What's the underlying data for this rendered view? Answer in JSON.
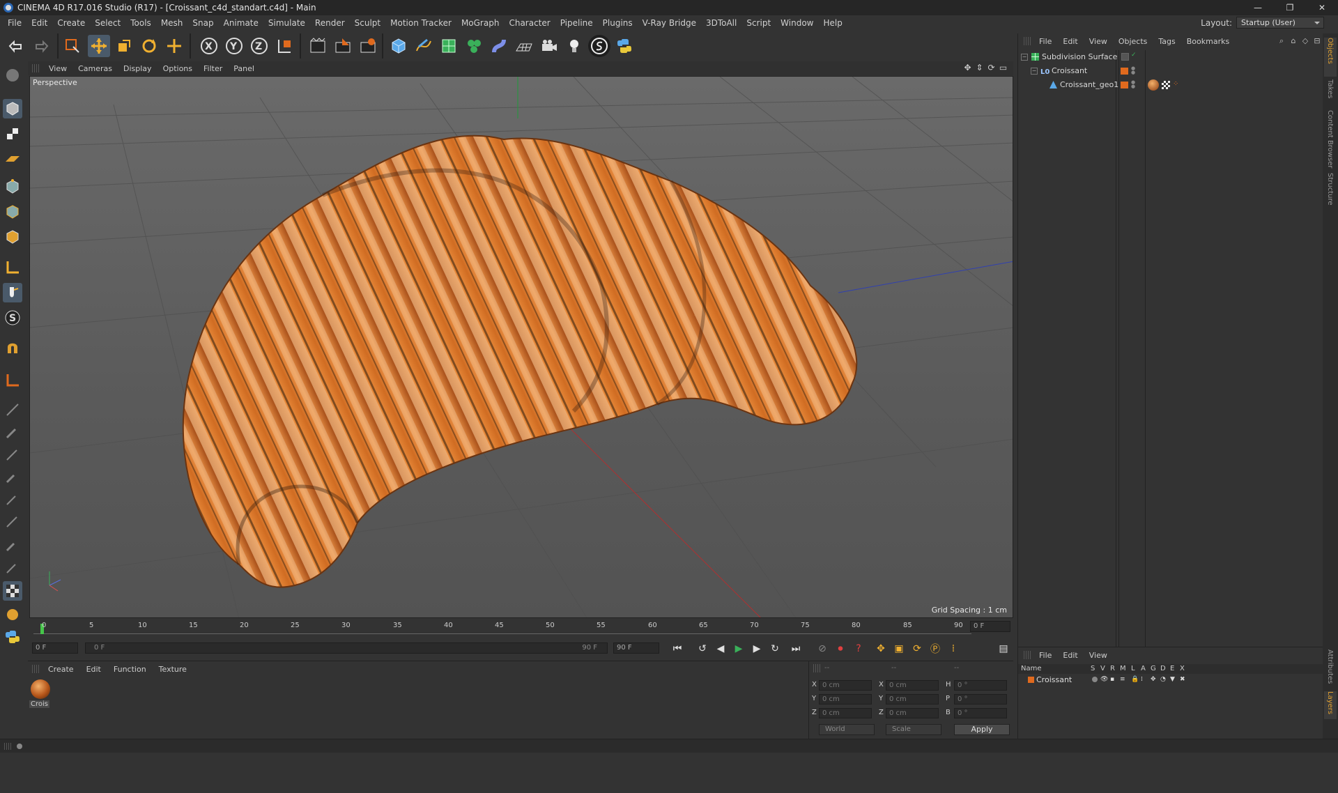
{
  "title": "CINEMA 4D R17.016 Studio (R17) - [Croissant_c4d_standart.c4d] - Main",
  "window_controls": [
    "—",
    "❐",
    "✕"
  ],
  "menu": [
    "File",
    "Edit",
    "Create",
    "Select",
    "Tools",
    "Mesh",
    "Snap",
    "Animate",
    "Simulate",
    "Render",
    "Sculpt",
    "Motion Tracker",
    "MoGraph",
    "Character",
    "Pipeline",
    "Plugins",
    "V-Ray Bridge",
    "3DToAll",
    "Script",
    "Window",
    "Help"
  ],
  "layout": {
    "label": "Layout:",
    "value": "Startup (User)"
  },
  "viewport": {
    "menu": [
      "View",
      "Cameras",
      "Display",
      "Options",
      "Filter",
      "Panel"
    ],
    "label": "Perspective",
    "grid_spacing": "Grid Spacing : 1 cm"
  },
  "timeline": {
    "ticks": [
      "0",
      "5",
      "10",
      "15",
      "20",
      "25",
      "30",
      "35",
      "40",
      "45",
      "50",
      "55",
      "60",
      "65",
      "70",
      "75",
      "80",
      "85",
      "90"
    ],
    "current_frame": "0 F",
    "start_field": "0 F",
    "range_start": "0 F",
    "range_end": "90 F",
    "end_field": "90 F"
  },
  "material_manager": {
    "menu": [
      "Create",
      "Edit",
      "Function",
      "Texture"
    ],
    "material_name": "Crois"
  },
  "coordinates": {
    "rows": [
      {
        "a1": "X",
        "v1": "0 cm",
        "a2": "X",
        "v2": "0 cm",
        "a3": "H",
        "v3": "0 °"
      },
      {
        "a1": "Y",
        "v1": "0 cm",
        "a2": "Y",
        "v2": "0 cm",
        "a3": "P",
        "v3": "0 °"
      },
      {
        "a1": "Z",
        "v1": "0 cm",
        "a2": "Z",
        "v2": "0 cm",
        "a3": "B",
        "v3": "0 °"
      }
    ],
    "header": [
      "--",
      "--",
      "--"
    ],
    "world": "World",
    "scale": "Scale",
    "apply": "Apply"
  },
  "objects_panel": {
    "menu": [
      "File",
      "Edit",
      "View",
      "Objects",
      "Tags",
      "Bookmarks"
    ],
    "items": [
      {
        "name": "Subdivision Surface"
      },
      {
        "name": "Croissant"
      },
      {
        "name": "Croissant_geo1"
      }
    ]
  },
  "side_tabs": [
    "Objects",
    "Takes",
    "Content Browser",
    "Structure"
  ],
  "side_tabs_bottom": [
    "Attributes",
    "Layers"
  ],
  "layers_panel": {
    "menu": [
      "File",
      "Edit",
      "View"
    ],
    "columns": [
      "Name",
      "S",
      "V",
      "R",
      "M",
      "L",
      "A",
      "G",
      "D",
      "E",
      "X"
    ],
    "row_name": "Croissant"
  },
  "colors": {
    "accent_orange": "#e06a1e",
    "timeline_cursor": "#46c64a",
    "viewport_bg": "#626262"
  }
}
